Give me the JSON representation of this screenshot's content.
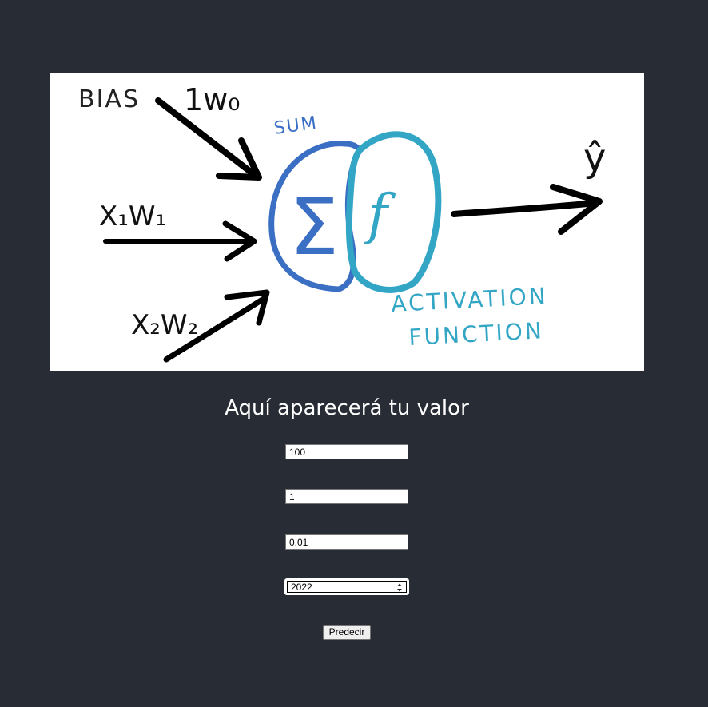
{
  "diagram": {
    "labels": {
      "bias": "BIAS",
      "w0": "1w₀",
      "x1w1": "X₁W₁",
      "x2w2": "X₂W₂",
      "sum": "SUM",
      "sigma": "Σ",
      "f": "f",
      "activation_line1": "ACTIVATION",
      "activation_line2": "FUNCTION",
      "output": "ŷ"
    },
    "colors": {
      "sum_circle": "#3a6fc4",
      "activation_circle": "#33a6c6",
      "ink": "#000000"
    }
  },
  "result": {
    "text": "Aquí aparecerá tu valor"
  },
  "form": {
    "field1_value": "100",
    "field2_value": "1",
    "field3_value": "0.01",
    "field4_value": "2022",
    "submit_label": "Predecir"
  }
}
